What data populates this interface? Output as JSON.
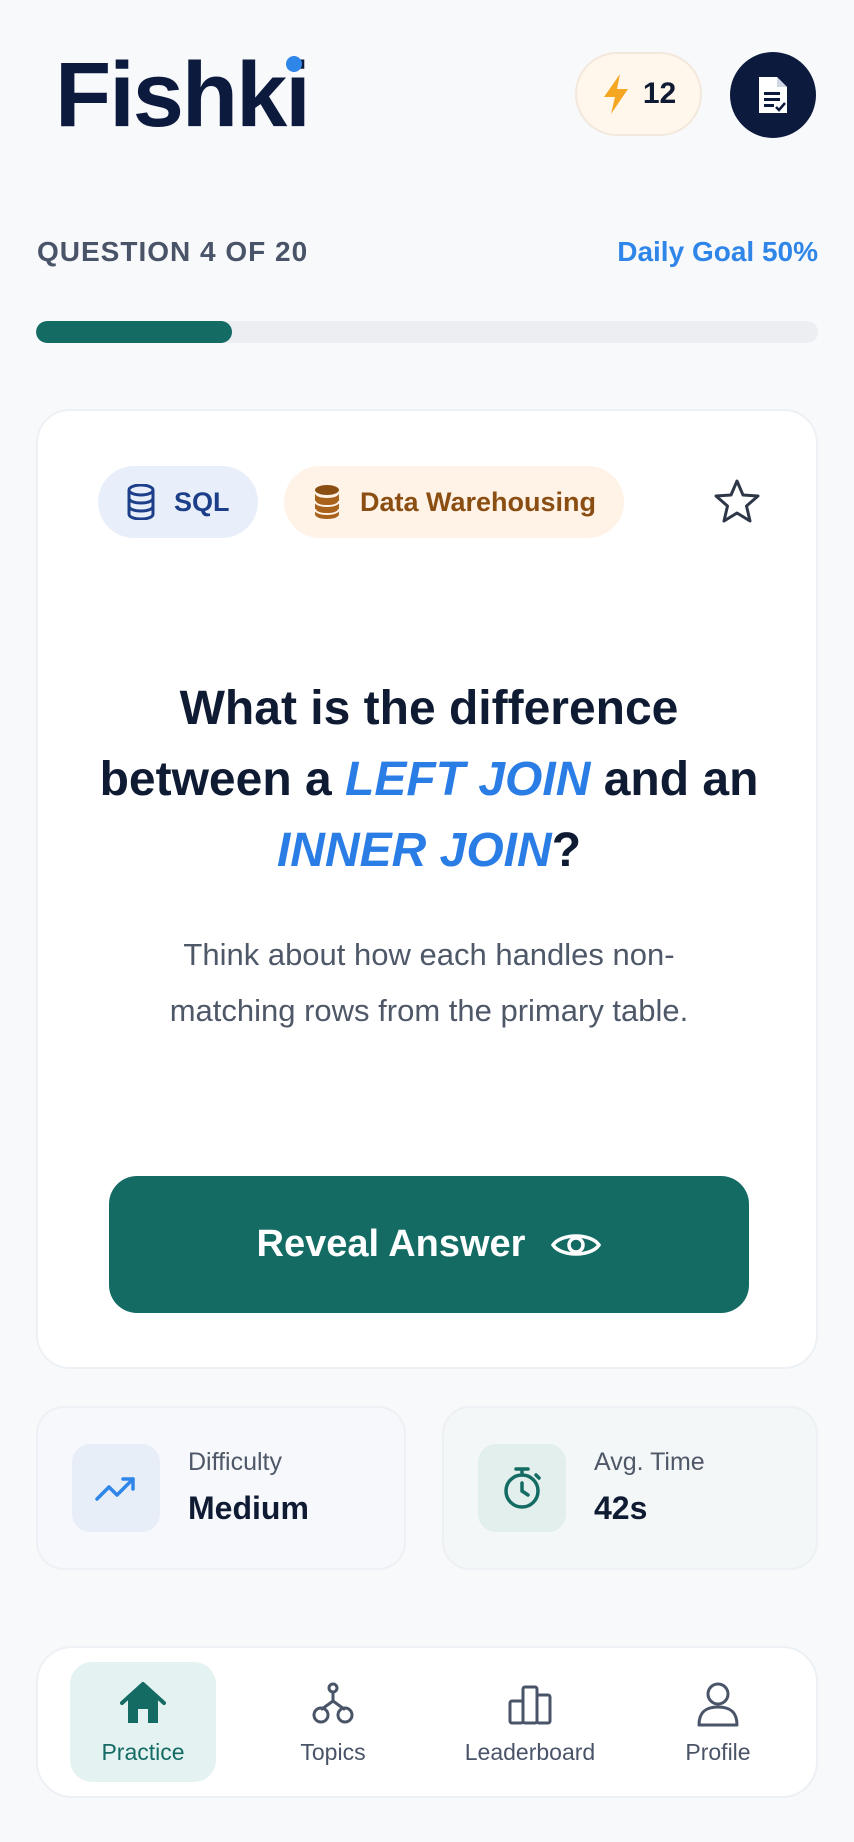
{
  "app": {
    "name": "Fishki"
  },
  "header": {
    "streak_count": "12"
  },
  "progress": {
    "question_label": "QUESTION 4 OF 20",
    "daily_goal_label": "Daily Goal 50%",
    "fraction": 0.25
  },
  "card": {
    "tags": [
      {
        "label": "SQL",
        "icon": "database-icon"
      },
      {
        "label": "Data Warehousing",
        "icon": "database-icon"
      }
    ],
    "question": {
      "part1": "What is the difference between a ",
      "highlight1": "LEFT JOIN",
      "part2": " and an ",
      "highlight2": "INNER JOIN",
      "part3": "?"
    },
    "hint": "Think about how each handles non-matching rows from the primary table.",
    "reveal_label": "Reveal Answer"
  },
  "stats": {
    "difficulty": {
      "label": "Difficulty",
      "value": "Medium"
    },
    "avg_time": {
      "label": "Avg. Time",
      "value": "42s"
    }
  },
  "nav": {
    "items": [
      {
        "label": "Practice",
        "icon": "home-icon",
        "active": true
      },
      {
        "label": "Topics",
        "icon": "topics-icon",
        "active": false
      },
      {
        "label": "Leaderboard",
        "icon": "leaderboard-icon",
        "active": false
      },
      {
        "label": "Profile",
        "icon": "profile-icon",
        "active": false
      }
    ]
  },
  "colors": {
    "primary": "#146b64",
    "accent": "#2f86e8",
    "brand_dark": "#0c1a3d",
    "streak": "#f5a623"
  }
}
